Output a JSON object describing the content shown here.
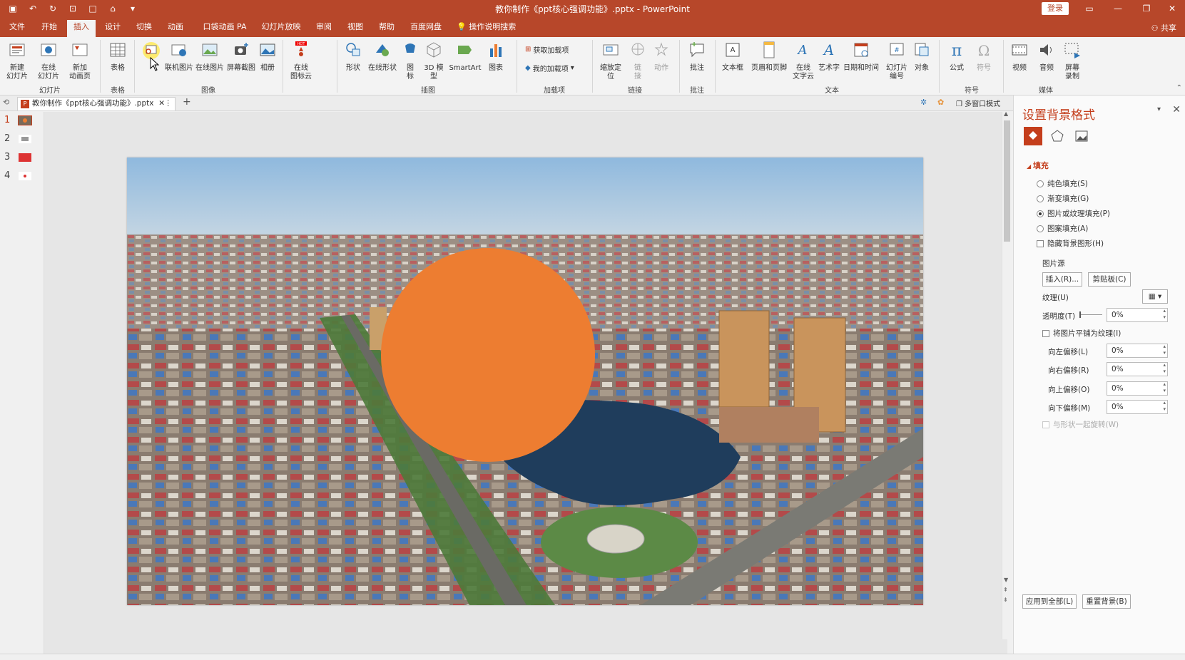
{
  "titlebar": {
    "title": "教你制作《ppt核心强调功能》.pptx  -  PowerPoint",
    "login_label": "登录",
    "accent": "#b7472a"
  },
  "tabs": [
    "文件",
    "开始",
    "插入",
    "设计",
    "切换",
    "动画",
    "口袋动画 PA",
    "幻灯片放映",
    "审阅",
    "视图",
    "帮助",
    "百度网盘"
  ],
  "tell_me": "操作说明搜索",
  "share_label": "共享",
  "ribbon": {
    "new_slide": "新建\n幻灯片",
    "online_slide": "在线\n幻灯片",
    "new_anim_page": "新加\n动画页",
    "table": "表格",
    "picture": "图片",
    "online_picture_left": "联机图片",
    "online_picture": "在线图片",
    "screenshot": "屏幕截图",
    "album": "相册",
    "online_icon_cloud": "在线\n图标云",
    "shapes": "形状",
    "online_shapes": "在线形状",
    "icons": "图\n标",
    "model3d": "3D 模\n型",
    "smartart": "SmartArt",
    "chart": "图表",
    "get_addins": "获取加载项",
    "my_addins": "我的加载项",
    "zoom": "缩放定\n位",
    "link": "链\n接",
    "action": "动作",
    "comment": "批注",
    "textbox": "文本框",
    "header_footer": "页眉和页脚",
    "online_wordcloud": "在线\n文字云",
    "wordart": "艺术字",
    "datetime": "日期和时间",
    "slide_number": "幻灯片\n编号",
    "object": "对象",
    "equation": "公式",
    "symbol": "符号",
    "video": "视频",
    "audio": "音频",
    "screen_record": "屏幕\n录制",
    "groups": [
      "幻灯片",
      "表格",
      "图像",
      "插图",
      "加载项",
      "链接",
      "批注",
      "文本",
      "符号",
      "媒体"
    ]
  },
  "doc_tab": {
    "name": "教你制作《ppt核心强调功能》.pptx",
    "multi_window": "多窗口模式"
  },
  "thumbnails": [
    "1",
    "2",
    "3",
    "4"
  ],
  "slide": {
    "circle_color": "#ed7d31"
  },
  "pane": {
    "title": "设置背景格式",
    "section_fill": "填充",
    "options": [
      "纯色填充(S)",
      "渐变填充(G)",
      "图片或纹理填充(P)",
      "图案填充(A)"
    ],
    "selected_option": "图片或纹理填充(P)",
    "hide_bg": "隐藏背景图形(H)",
    "picture_source": "图片源",
    "insert_btn": "插入(R)...",
    "clipboard_btn": "剪贴板(C)",
    "texture": "纹理(U)",
    "transparency": "透明度(T)",
    "transparency_value": "0%",
    "tile": "将图片平铺为纹理(I)",
    "offset_left": "向左偏移(L)",
    "offset_right": "向右偏移(R)",
    "offset_up": "向上偏移(O)",
    "offset_down": "向下偏移(M)",
    "offset_value": "0%",
    "rotate_with_shape": "与形状一起旋转(W)",
    "apply_all": "应用到全部(L)",
    "reset_bg": "重置背景(B)"
  }
}
